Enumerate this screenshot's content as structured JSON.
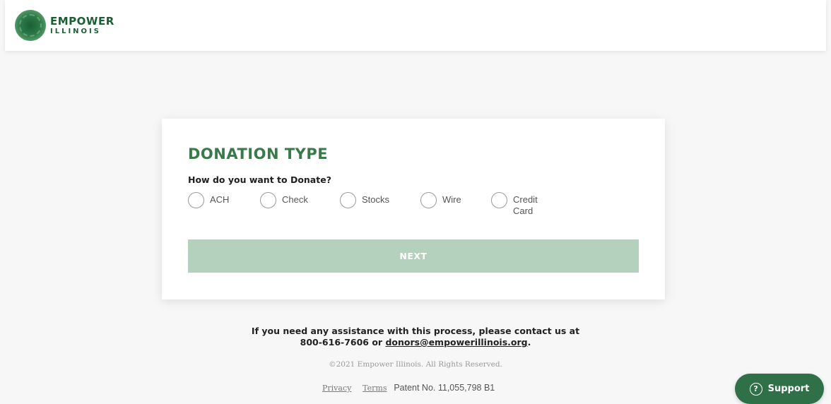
{
  "header": {
    "logo": {
      "line1": "EMPOWER",
      "line2": "ILLINOIS"
    }
  },
  "card": {
    "title": "DONATION TYPE",
    "question": "How do you want to Donate?",
    "options": [
      {
        "label": "ACH",
        "selected": false
      },
      {
        "label": "Check",
        "selected": false
      },
      {
        "label": "Stocks",
        "selected": false
      },
      {
        "label": "Wire",
        "selected": false
      },
      {
        "label": "Credit Card",
        "selected": false
      }
    ],
    "next_label": "NEXT"
  },
  "footer": {
    "assist_line1": "If you need any assistance with this process, please contact us at",
    "phone_prefix": "800-616-7606 or ",
    "email": "donors@empowerillinois.org",
    "email_suffix": ".",
    "copyright": "©2021 Empower Illinois. All Rights Reserved.",
    "privacy_label": "Privacy",
    "terms_label": "Terms",
    "patent": "Patent No. 11,055,798 B1"
  },
  "support": {
    "icon": "question-circle-icon",
    "label": "Support"
  },
  "colors": {
    "brand_green": "#3a7a4a",
    "button_disabled": "#b3d1bc",
    "support_green": "#2f7049"
  }
}
